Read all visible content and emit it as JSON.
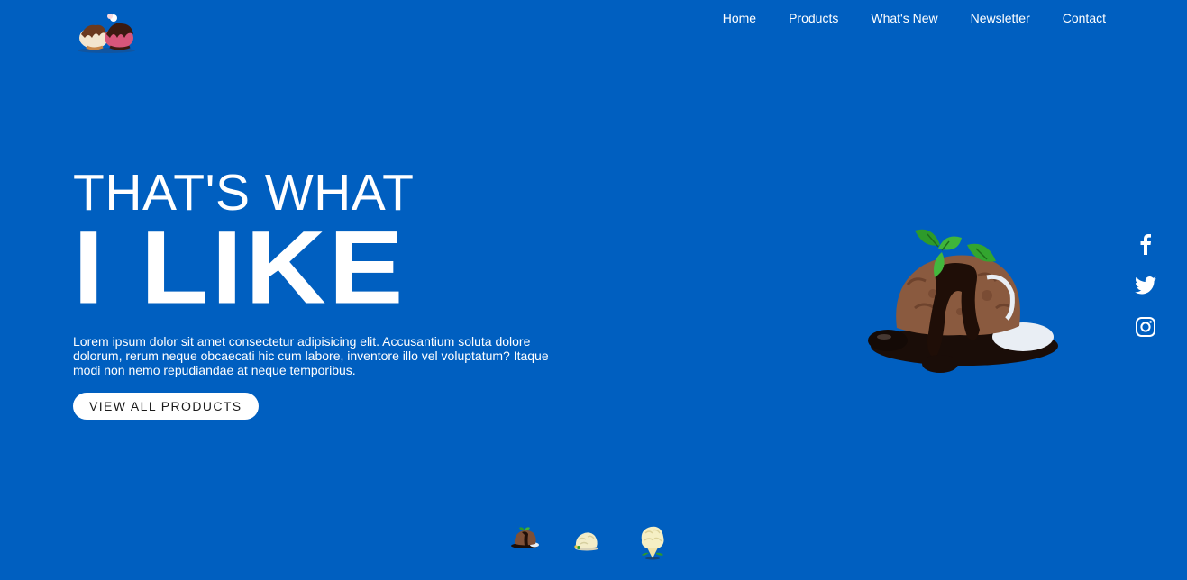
{
  "brand": {
    "logo_icon": "ice-cream-logo-icon"
  },
  "nav": {
    "items": [
      {
        "label": "Home"
      },
      {
        "label": "Products"
      },
      {
        "label": "What's New"
      },
      {
        "label": "Newsletter"
      },
      {
        "label": "Contact"
      }
    ]
  },
  "hero": {
    "subtitle": "THAT'S WHAT",
    "title": "I LIKE",
    "description": "Lorem ipsum dolor sit amet consectetur adipisicing elit. Accusantium soluta dolore dolorum, rerum neque obcaecati hic cum labore, inventore illo vel voluptatum? Itaque modi non nemo repudiandae at neque temporibus.",
    "cta_label": "VIEW ALL PRODUCTS",
    "feature_image": "chocolate-ice-cream-scoop"
  },
  "social": {
    "icons": [
      "facebook-icon",
      "twitter-icon",
      "instagram-icon"
    ]
  },
  "thumbnails": {
    "items": [
      "chocolate-scoop-thumb",
      "vanilla-scoop-thumb",
      "vanilla-cone-thumb"
    ]
  },
  "colors": {
    "background": "#005fc0",
    "text": "#ffffff",
    "button_bg": "#ffffff",
    "button_text": "#1a1a1a"
  }
}
